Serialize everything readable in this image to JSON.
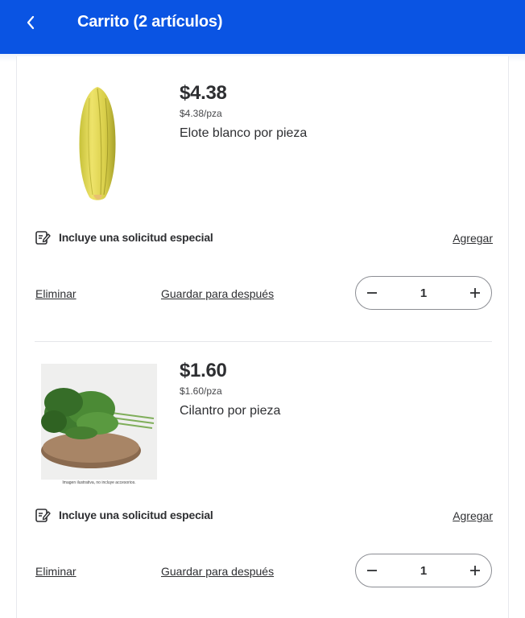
{
  "header": {
    "title": "Carrito (2 artículos)",
    "back_icon": "chevron-left-icon"
  },
  "colors": {
    "brand": "#0a54e3",
    "text": "#2e2f32"
  },
  "items": [
    {
      "price": "$4.38",
      "unit_price": "$4.38/pza",
      "name": "Elote blanco por pieza",
      "special_request": "Incluye una solicitud especial",
      "add_label": "Agregar",
      "remove_label": "Eliminar",
      "save_label": "Guardar para después",
      "quantity": "1",
      "image_caption": ""
    },
    {
      "price": "$1.60",
      "unit_price": "$1.60/pza",
      "name": "Cilantro por pieza",
      "special_request": "Incluye una solicitud especial",
      "add_label": "Agregar",
      "remove_label": "Eliminar",
      "save_label": "Guardar para después",
      "quantity": "1",
      "image_caption": "Imagen ilustrativa, no incluye accesorios."
    }
  ]
}
